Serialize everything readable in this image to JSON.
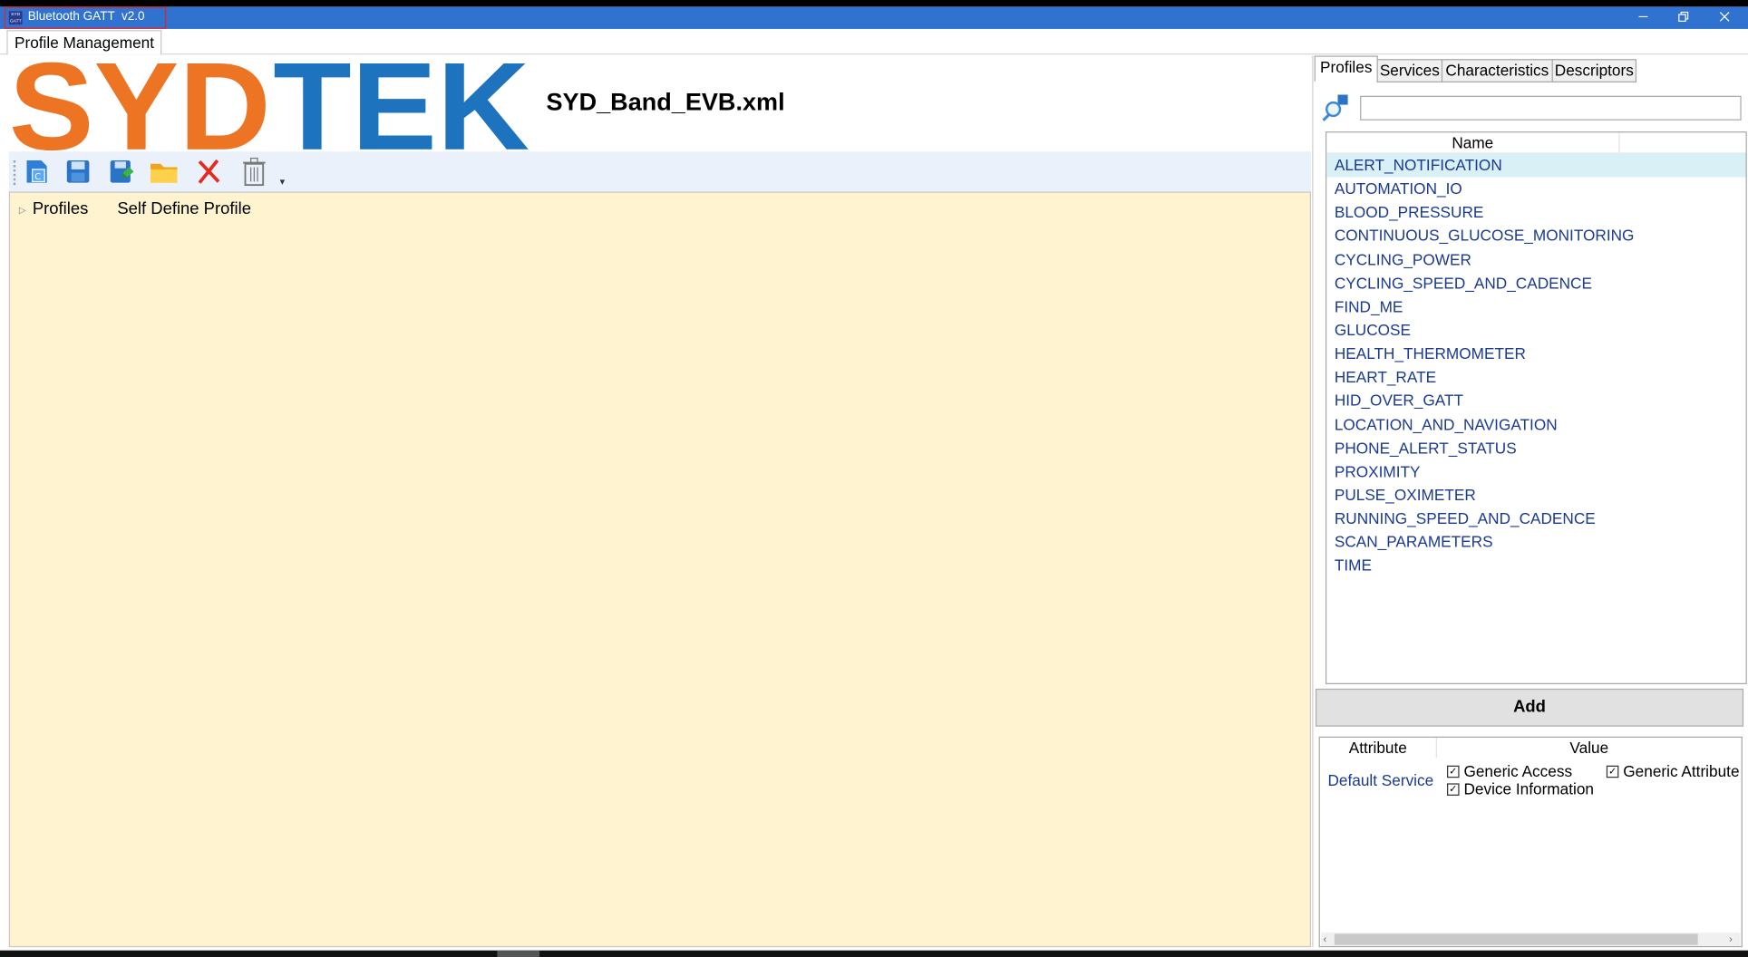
{
  "titlebar": {
    "title": "Bluetooth GATT  v2.0",
    "icon": "app-icon",
    "icon_text": "SYD GATT",
    "minimize": "minimize-icon",
    "restore": "restore-icon",
    "close": "close-icon"
  },
  "menu": {
    "tab_label": "Profile Management"
  },
  "header": {
    "logo_text": "SYDTEK",
    "logo_colors": {
      "syd": "#ec7423",
      "tek": "#1e73be"
    },
    "filename": "SYD_Band_EVB.xml"
  },
  "toolbar": {
    "buttons": [
      "new-file-icon",
      "save-icon",
      "save-as-icon",
      "open-folder-icon",
      "delete-icon",
      "trash-icon"
    ],
    "more": "▾"
  },
  "tree": {
    "root_label": "Profiles",
    "root_value": "Self Define Profile"
  },
  "right": {
    "tabs": [
      "Profiles",
      "Services",
      "Characteristics",
      "Descriptors"
    ],
    "search": {
      "placeholder": "",
      "value": ""
    },
    "list": {
      "column": "Name",
      "items": [
        "ALERT_NOTIFICATION",
        "AUTOMATION_IO",
        "BLOOD_PRESSURE",
        "CONTINUOUS_GLUCOSE_MONITORING",
        "CYCLING_POWER",
        "CYCLING_SPEED_AND_CADENCE",
        "FIND_ME",
        "GLUCOSE",
        "HEALTH_THERMOMETER",
        "HEART_RATE",
        "HID_OVER_GATT",
        "LOCATION_AND_NAVIGATION",
        "PHONE_ALERT_STATUS",
        "PROXIMITY",
        "PULSE_OXIMETER",
        "RUNNING_SPEED_AND_CADENCE",
        "SCAN_PARAMETERS",
        "TIME"
      ],
      "selected_index": 0
    },
    "add_label": "Add",
    "attributes": {
      "header_attribute": "Attribute",
      "header_value": "Value",
      "key": "Default Service",
      "options": [
        {
          "label": "Generic Access",
          "checked": true
        },
        {
          "label": "Generic Attribute",
          "checked": true
        },
        {
          "label": "Device Information",
          "checked": true
        }
      ]
    }
  }
}
